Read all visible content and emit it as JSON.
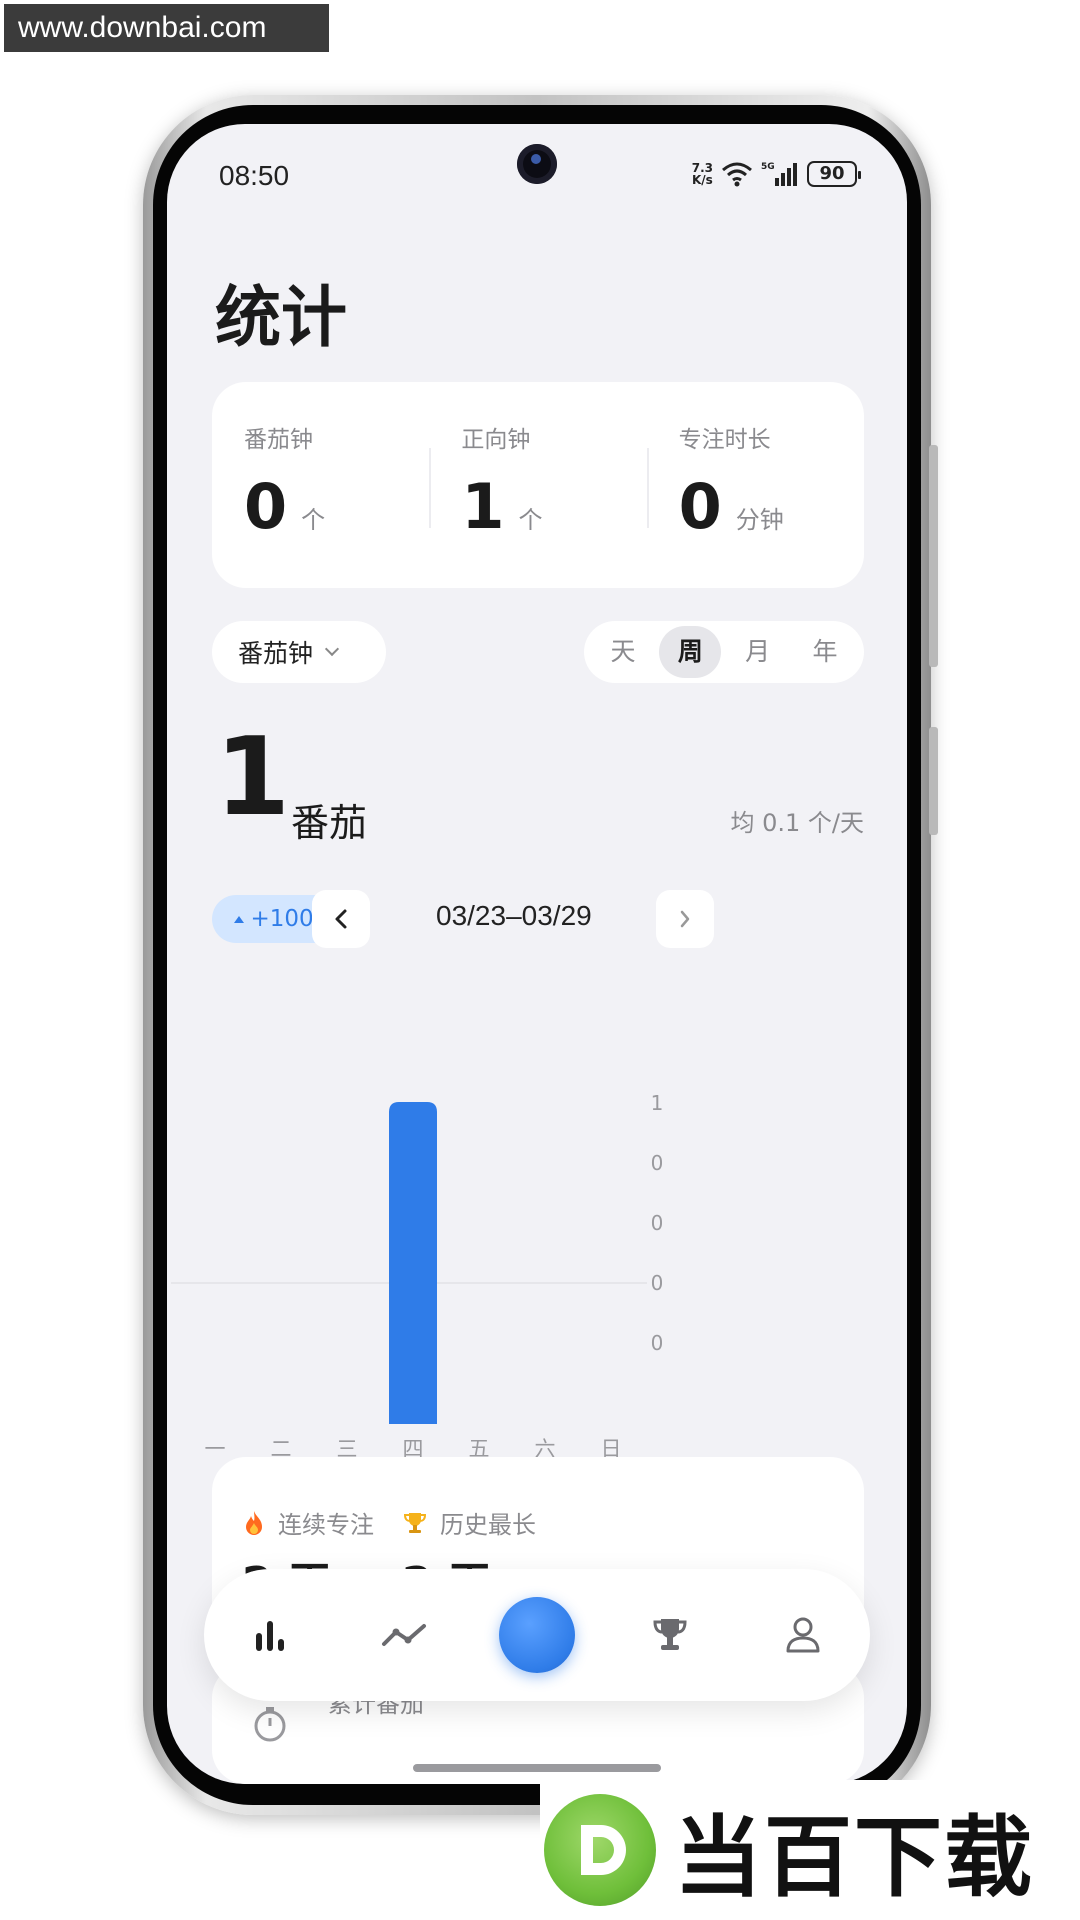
{
  "watermark_top": "www.downbai.com",
  "status_bar": {
    "time": "08:50",
    "net_speed_value": "7.3",
    "net_speed_unit": "K/s",
    "battery": "90"
  },
  "page": {
    "title": "统计"
  },
  "summary": [
    {
      "label": "番茄钟",
      "value": "0",
      "unit": "个"
    },
    {
      "label": "正向钟",
      "value": "1",
      "unit": "个"
    },
    {
      "label": "专注时长",
      "value": "0",
      "unit": "分钟"
    }
  ],
  "filter": {
    "type_selected": "番茄钟",
    "ranges": [
      "天",
      "周",
      "月",
      "年"
    ],
    "active_range": "周"
  },
  "total": {
    "value": "1",
    "unit": "番茄",
    "average": "均 0.1 个/天",
    "change": "+100%",
    "date_range": "03/23–03/29"
  },
  "chart_data": {
    "type": "bar",
    "categories": [
      "一",
      "二",
      "三",
      "四",
      "五",
      "六",
      "日"
    ],
    "values": [
      0,
      0,
      0,
      1,
      0,
      0,
      0
    ],
    "y_tick_labels": [
      "1",
      "0",
      "0",
      "0",
      "0"
    ],
    "ylim": [
      0,
      1
    ],
    "bar_color": "#2f7ce8",
    "grid": false
  },
  "stats": {
    "streak_label": "连续专注",
    "streak_value": "2 天",
    "best_label": "历史最长",
    "best_value": "2 天"
  },
  "cumulative": {
    "label": "累计番茄"
  },
  "tab_bar": {
    "items": [
      "stats-icon",
      "trend-icon",
      "start-focus",
      "trophy-icon",
      "profile-icon"
    ]
  },
  "logo_text": "当百下载",
  "colors": {
    "accent": "#2f7ce8",
    "background": "#f2f2f6"
  }
}
